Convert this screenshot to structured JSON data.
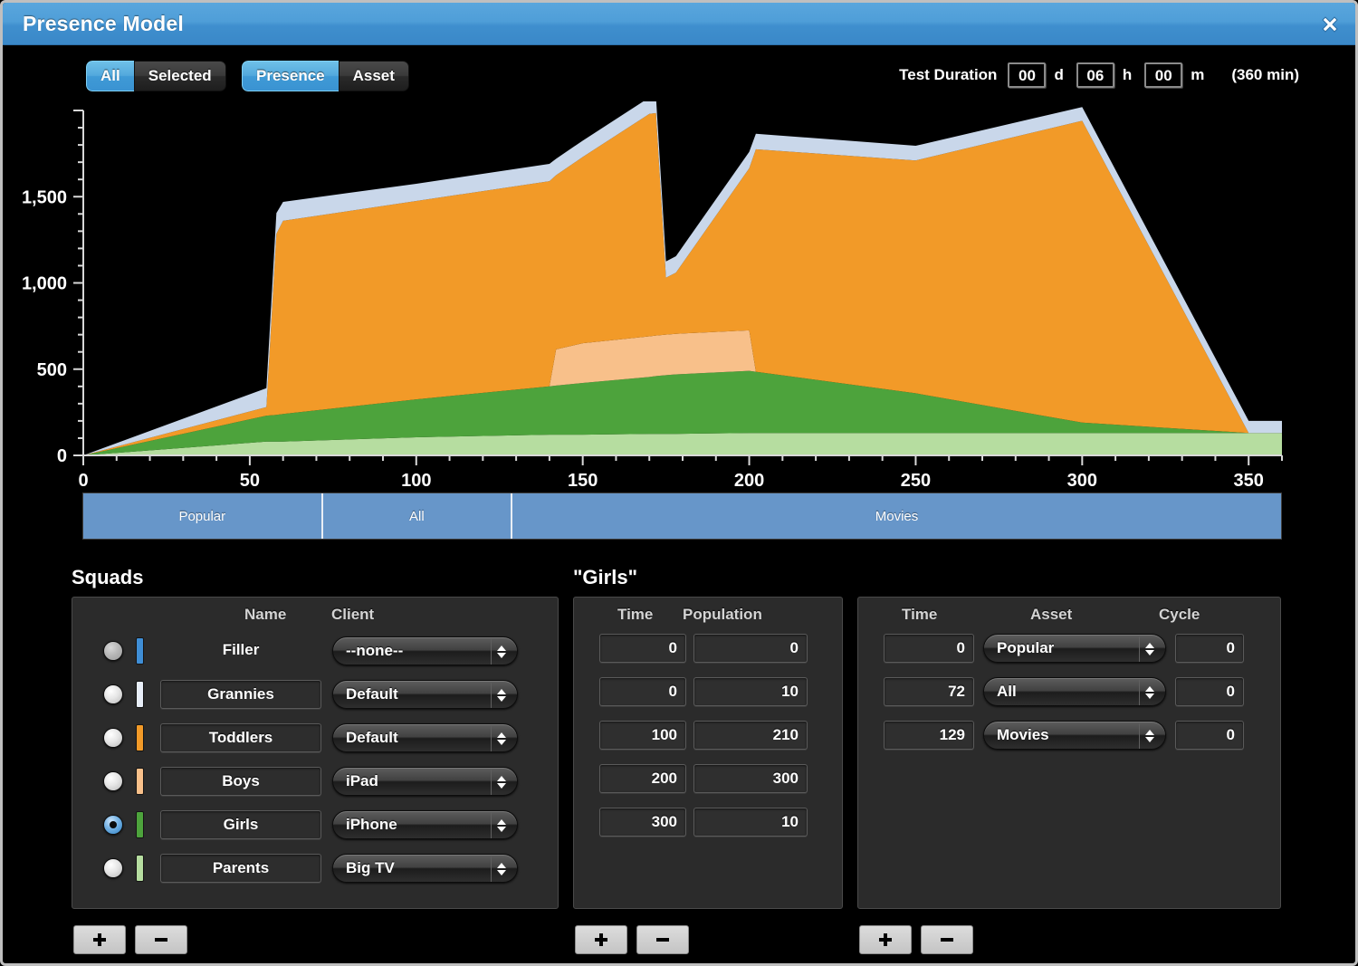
{
  "window": {
    "title": "Presence Model",
    "close_icon": "close-icon"
  },
  "toolbar": {
    "scope_group": [
      {
        "label": "All",
        "active": true
      },
      {
        "label": "Selected",
        "active": false
      }
    ],
    "mode_group": [
      {
        "label": "Presence",
        "active": true
      },
      {
        "label": "Asset",
        "active": false
      }
    ],
    "duration": {
      "label": "Test Duration",
      "days": "00",
      "days_unit": "d",
      "hours": "06",
      "hours_unit": "h",
      "minutes": "00",
      "minutes_unit": "m",
      "total": "(360 min)"
    }
  },
  "chart_data": {
    "type": "area",
    "title": "",
    "xlabel": "",
    "ylabel": "",
    "xlim": [
      0,
      360
    ],
    "ylim": [
      0,
      2000
    ],
    "xticks": [
      0,
      50,
      100,
      150,
      200,
      250,
      300,
      350
    ],
    "yticks": [
      0,
      500,
      1000,
      1500
    ],
    "ytick_labels": [
      "0",
      "500",
      "1,000",
      "1,500"
    ],
    "xtick_labels": [
      "0",
      "50",
      "100",
      "150",
      "200",
      "250",
      "300",
      "350"
    ],
    "minor_tick_step": 10,
    "grid": false,
    "legend": "none",
    "stacked": true,
    "background": "#000000",
    "x": [
      0,
      55,
      58,
      60,
      100,
      140,
      142,
      150,
      170,
      172,
      175,
      178,
      200,
      202,
      250,
      300,
      350,
      360
    ],
    "series": [
      {
        "name": "Parents",
        "color": "#b6dda0",
        "values": [
          0,
          80,
          80,
          80,
          105,
          120,
          120,
          120,
          125,
          125,
          125,
          125,
          130,
          130,
          130,
          130,
          130,
          130
        ]
      },
      {
        "name": "Girls",
        "color": "#4da33c",
        "values": [
          0,
          150,
          155,
          160,
          220,
          280,
          285,
          300,
          330,
          335,
          340,
          345,
          360,
          355,
          230,
          60,
          0,
          0
        ]
      },
      {
        "name": "Boys",
        "color": "#f8c08a",
        "values": [
          0,
          0,
          0,
          0,
          0,
          0,
          210,
          230,
          235,
          235,
          235,
          235,
          235,
          0,
          0,
          0,
          0,
          0
        ]
      },
      {
        "name": "Toddlers",
        "color": "#f29a28",
        "values": [
          0,
          50,
          1050,
          1120,
          1150,
          1190,
          1010,
          1080,
          1290,
          1290,
          330,
          355,
          940,
          1290,
          1350,
          1750,
          0,
          0
        ]
      },
      {
        "name": "Grannies",
        "color": "#c9d7ea",
        "values": [
          0,
          110,
          120,
          110,
          100,
          100,
          95,
          95,
          95,
          95,
          95,
          95,
          95,
          90,
          85,
          80,
          70,
          70
        ]
      }
    ],
    "timeline": [
      {
        "label": "Popular",
        "start": 0,
        "end": 72
      },
      {
        "label": "All",
        "start": 72,
        "end": 129
      },
      {
        "label": "Movies",
        "start": 129,
        "end": 360
      }
    ]
  },
  "squads": {
    "title": "Squads",
    "headers": {
      "name": "Name",
      "client": "Client"
    },
    "rows": [
      {
        "name": "Filler",
        "client": "--none--",
        "color": "#3f8ed6",
        "selected": false,
        "editable": false
      },
      {
        "name": "Grannies",
        "client": "Default",
        "color": "#e8eef8",
        "selected": false,
        "editable": true
      },
      {
        "name": "Toddlers",
        "client": "Default",
        "color": "#f29a28",
        "selected": false,
        "editable": true
      },
      {
        "name": "Boys",
        "client": "iPad",
        "color": "#f8c08a",
        "selected": false,
        "editable": true
      },
      {
        "name": "Girls",
        "client": "iPhone",
        "color": "#4da33c",
        "selected": true,
        "editable": true
      },
      {
        "name": "Parents",
        "client": "Big TV",
        "color": "#b6dda0",
        "selected": false,
        "editable": true
      }
    ],
    "add_label": "plus-icon",
    "remove_label": "minus-icon"
  },
  "population": {
    "title": "\"Girls\"",
    "headers": {
      "time": "Time",
      "population": "Population"
    },
    "rows": [
      {
        "time": "0",
        "population": "0"
      },
      {
        "time": "0",
        "population": "10"
      },
      {
        "time": "100",
        "population": "210"
      },
      {
        "time": "200",
        "population": "300"
      },
      {
        "time": "300",
        "population": "10"
      }
    ]
  },
  "assets": {
    "headers": {
      "time": "Time",
      "asset": "Asset",
      "cycle": "Cycle"
    },
    "rows": [
      {
        "time": "0",
        "asset": "Popular",
        "cycle": "0"
      },
      {
        "time": "72",
        "asset": "All",
        "cycle": "0"
      },
      {
        "time": "129",
        "asset": "Movies",
        "cycle": "0"
      }
    ]
  }
}
